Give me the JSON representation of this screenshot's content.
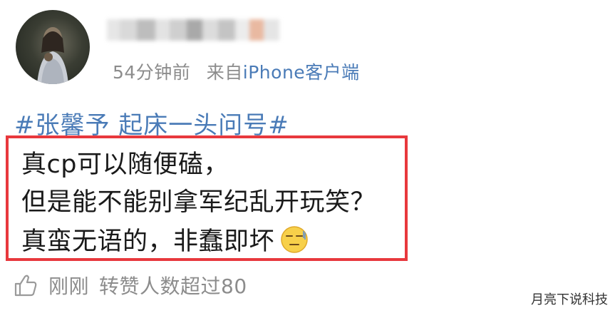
{
  "post": {
    "time": "54分钟前",
    "source_prefix": "来自",
    "source": "iPhone客户端",
    "topic": "#张馨予 起床一头问号#",
    "lines": [
      "真cp可以随便磕，",
      "但是能不能别拿军纪乱开玩笑？",
      "真蛮无语的，非蠢即坏"
    ],
    "emoji": "speechless-face-emoji",
    "footer": {
      "time": "刚刚",
      "reposts": "转赞人数超过80"
    }
  },
  "watermark": "月亮下说科技",
  "colors": {
    "link": "#4a7bb7",
    "meta": "#8c8c8c",
    "highlight_border": "#e8383d"
  },
  "icons": {
    "avatar": "avatar",
    "like": "thumbs-up-icon"
  }
}
